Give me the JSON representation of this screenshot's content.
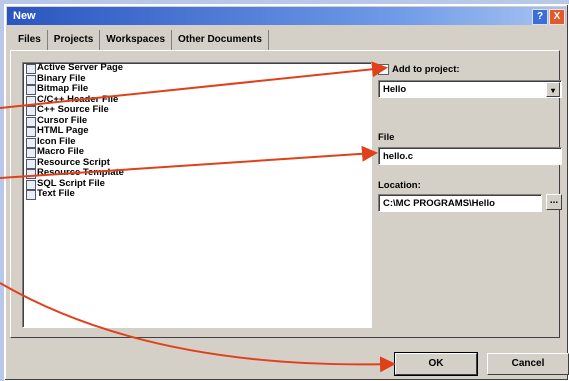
{
  "window": {
    "title": "New",
    "help_symbol": "?",
    "close_symbol": "X"
  },
  "tabs": [
    {
      "label": "Files"
    },
    {
      "label": "Projects"
    },
    {
      "label": "Workspaces"
    },
    {
      "label": "Other Documents"
    }
  ],
  "file_types": [
    "Active Server Page",
    "Binary File",
    "Bitmap File",
    "C/C++ Header File",
    "C++ Source File",
    "Cursor File",
    "HTML Page",
    "Icon File",
    "Macro File",
    "Resource Script",
    "Resource Template",
    "SQL Script File",
    "Text File"
  ],
  "project": {
    "add_label": "Add to project:",
    "checked_symbol": "✓",
    "selected": "Hello",
    "dropdown_symbol": "▾"
  },
  "file": {
    "label": "File",
    "value": "hello.c"
  },
  "location": {
    "label": "Location:",
    "value": "C:\\MC PROGRAMS\\Hello",
    "browse_label": "..."
  },
  "buttons": {
    "ok": "OK",
    "cancel": "Cancel"
  },
  "colors": {
    "arrow": "#e0401a",
    "titlebar": "#2a55c0"
  }
}
